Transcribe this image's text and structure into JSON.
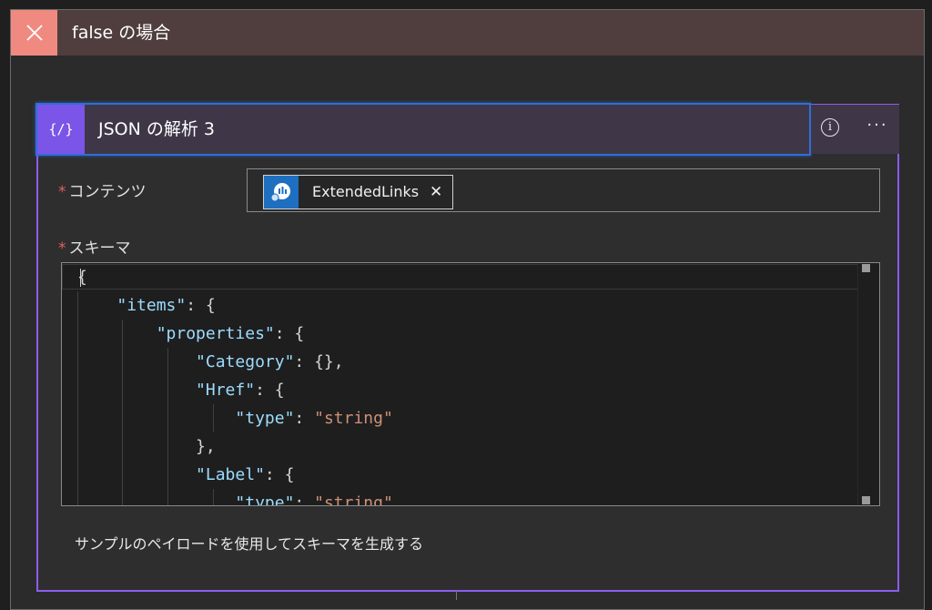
{
  "scope": {
    "title": "false の場合",
    "close_icon": "close-icon",
    "header_color": "#4f3e3d",
    "close_color": "#f08a80"
  },
  "action": {
    "title": "JSON の解析 3",
    "icon_glyph": "{/}",
    "icon_name": "json-parse-icon",
    "accent": "#7a55e8",
    "info_glyph": "i",
    "more_glyph": "···"
  },
  "content_field": {
    "required_mark": "*",
    "label": "コンテンツ",
    "token": {
      "label": "ExtendedLinks",
      "remove_glyph": "✕",
      "icon_name": "dynamic-content-icon"
    }
  },
  "schema_field": {
    "required_mark": "*",
    "label": "スキーマ",
    "code_lines": [
      "{",
      "    \"items\": {",
      "        \"properties\": {",
      "            \"Category\": {},",
      "            \"Href\": {",
      "                \"type\": \"string\"",
      "            },",
      "            \"Label\": {",
      "                \"type\": \"string\""
    ]
  },
  "sample_link": "サンプルのペイロードを使用してスキーマを生成する"
}
